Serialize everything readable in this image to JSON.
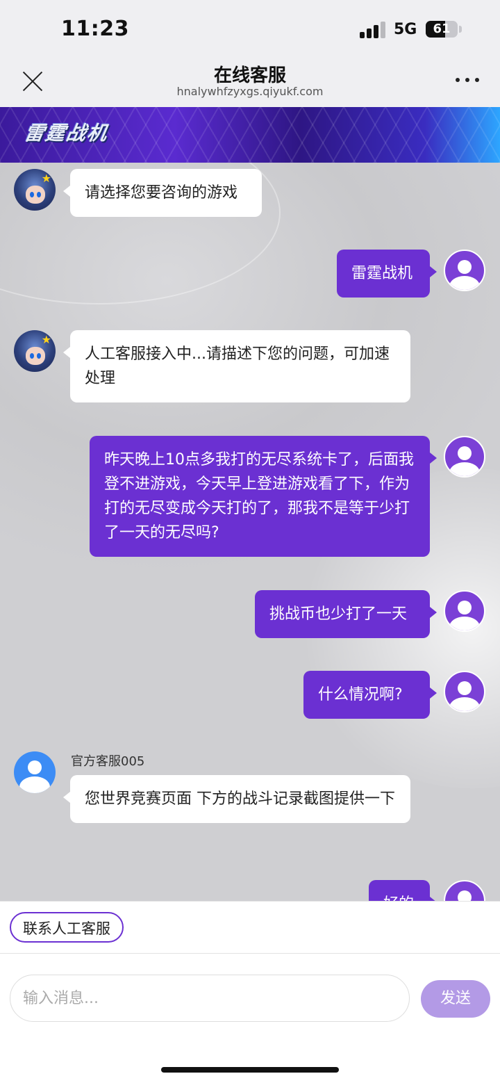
{
  "status": {
    "time": "11:23",
    "network": "5G",
    "battery": "61",
    "battery_level": 0.61
  },
  "nav": {
    "title": "在线客服",
    "url": "hnalywhfzyxgs.qiyukf.com",
    "close_icon": "close-icon",
    "more_icon": "more-icon"
  },
  "banner": {
    "logo_text": "雷霆战机"
  },
  "messages": [
    {
      "side": "left",
      "text": "请选择您要咨询的游戏"
    },
    {
      "side": "right",
      "text": "雷霆战机"
    },
    {
      "side": "left",
      "text": "人工客服接入中...请描述下您的问题，可加速处理"
    },
    {
      "side": "right",
      "text": "昨天晚上10点多我打的无尽系统卡了，后面我登不进游戏，今天早上登进游戏看了下，作为打的无尽变成今天打的了，那我不是等于少打了一天的无尽吗?"
    },
    {
      "side": "right",
      "text": "挑战币也少打了一天"
    },
    {
      "side": "right",
      "text": "什么情况啊?"
    },
    {
      "side": "left",
      "sender": "官方客服005",
      "text": "您世界竞赛页面 下方的战斗记录截图提供一下"
    },
    {
      "side": "right",
      "text": "好的"
    }
  ],
  "quick_reply": {
    "label": "联系人工客服"
  },
  "composer": {
    "placeholder": "输入消息...",
    "value": "",
    "send_label": "发送"
  },
  "colors": {
    "accent": "#6b30d2",
    "send_disabled": "#b39ae6",
    "official_avatar": "#3c8cf5"
  }
}
